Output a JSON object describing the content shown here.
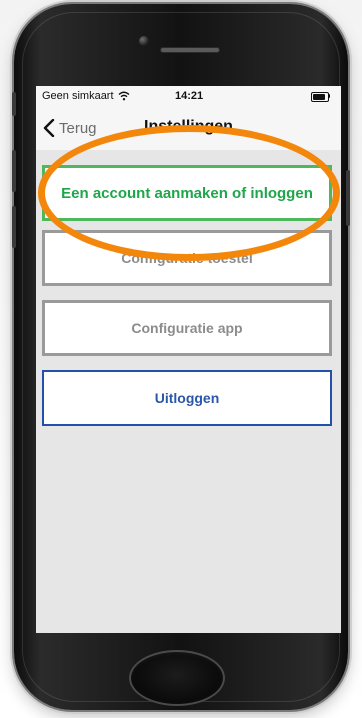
{
  "status_bar": {
    "carrier": "Geen simkaart",
    "time": "14:21",
    "wifi_icon": "wifi-icon",
    "battery_icon": "battery-icon"
  },
  "nav_bar": {
    "back_label": "Terug",
    "back_icon": "chevron-left-icon",
    "title": "Instellingen"
  },
  "menu": {
    "items": [
      {
        "label": "Een account aanmaken of inloggen",
        "color": "#1ea64a",
        "border": "#4fb85d"
      },
      {
        "label": "Configuratie toestel",
        "color": "#8c8c8c",
        "border": "#9a9a9a"
      },
      {
        "label": "Configuratie app",
        "color": "#8c8c8c",
        "border": "#9a9a9a"
      },
      {
        "label": "Uitloggen",
        "color": "#2b57a8",
        "border": "#2350a9"
      }
    ]
  },
  "annotation": {
    "highlight_color": "#f3870c"
  },
  "device": {
    "frame_color": "#111111",
    "screen_bg": "#e6e6e6"
  }
}
